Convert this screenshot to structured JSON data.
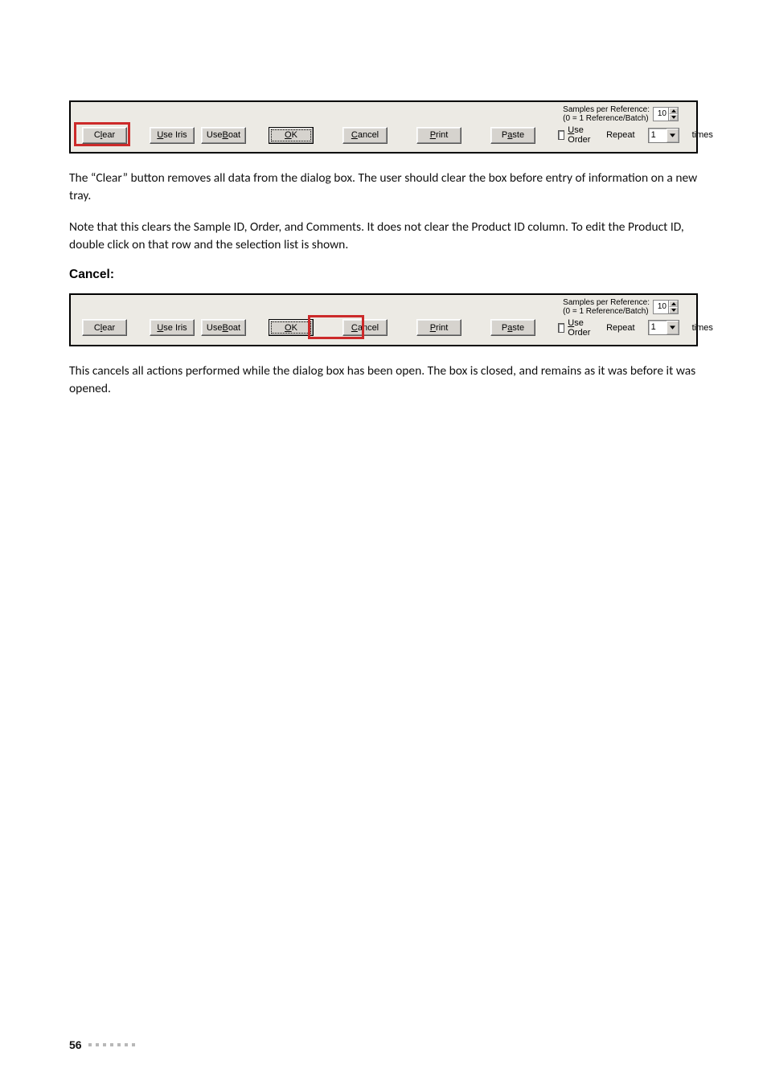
{
  "dialog1": {
    "samples_label_line1": "Samples per Reference:",
    "samples_label_line2": "(0 = 1 Reference/Batch)",
    "samples_value": "10",
    "btn_clear_pre": "C",
    "btn_clear_u": "l",
    "btn_clear_post": "ear",
    "btn_useiris_u": "U",
    "btn_useiris_post": "se Iris",
    "btn_useboat_pre": "Use ",
    "btn_useboat_u": "B",
    "btn_useboat_post": "oat",
    "btn_ok_u": "O",
    "btn_ok_post": "K",
    "btn_cancel_u": "C",
    "btn_cancel_post": "ancel",
    "btn_print_u": "P",
    "btn_print_post": "rint",
    "btn_paste_pre": "P",
    "btn_paste_u": "a",
    "btn_paste_post": "ste",
    "chk_useorder_u": "U",
    "chk_useorder_post": "se Order",
    "repeat_label": "Repeat",
    "repeat_value": "1",
    "times_label": "times"
  },
  "para1": "The “Clear” button removes all data from the dialog box. The user should clear the box before entry of information on a new tray.",
  "para2": "Note that this clears the Sample ID, Order, and Comments. It does not clear the Product ID column. To edit the Product ID, double click on that row and the selection list is shown.",
  "heading_cancel": "Cancel:",
  "dialog2": {
    "samples_label_line1": "Samples per Reference:",
    "samples_label_line2": "(0 = 1 Reference/Batch)",
    "samples_value": "10",
    "btn_clear_pre": "C",
    "btn_clear_u": "l",
    "btn_clear_post": "ear",
    "btn_useiris_u": "U",
    "btn_useiris_post": "se Iris",
    "btn_useboat_pre": "Use ",
    "btn_useboat_u": "B",
    "btn_useboat_post": "oat",
    "btn_ok_u": "O",
    "btn_ok_post": "K",
    "btn_cancel_u": "C",
    "btn_cancel_post": "ancel",
    "btn_print_u": "P",
    "btn_print_post": "rint",
    "btn_paste_pre": "P",
    "btn_paste_u": "a",
    "btn_paste_post": "ste",
    "chk_useorder_u": "U",
    "chk_useorder_post": "se Order",
    "repeat_label": "Repeat",
    "repeat_value": "1",
    "times_label": "times"
  },
  "para3": "This cancels all actions performed while the dialog box has been open. The box is closed, and remains as it was before it was opened.",
  "page_number": "56"
}
